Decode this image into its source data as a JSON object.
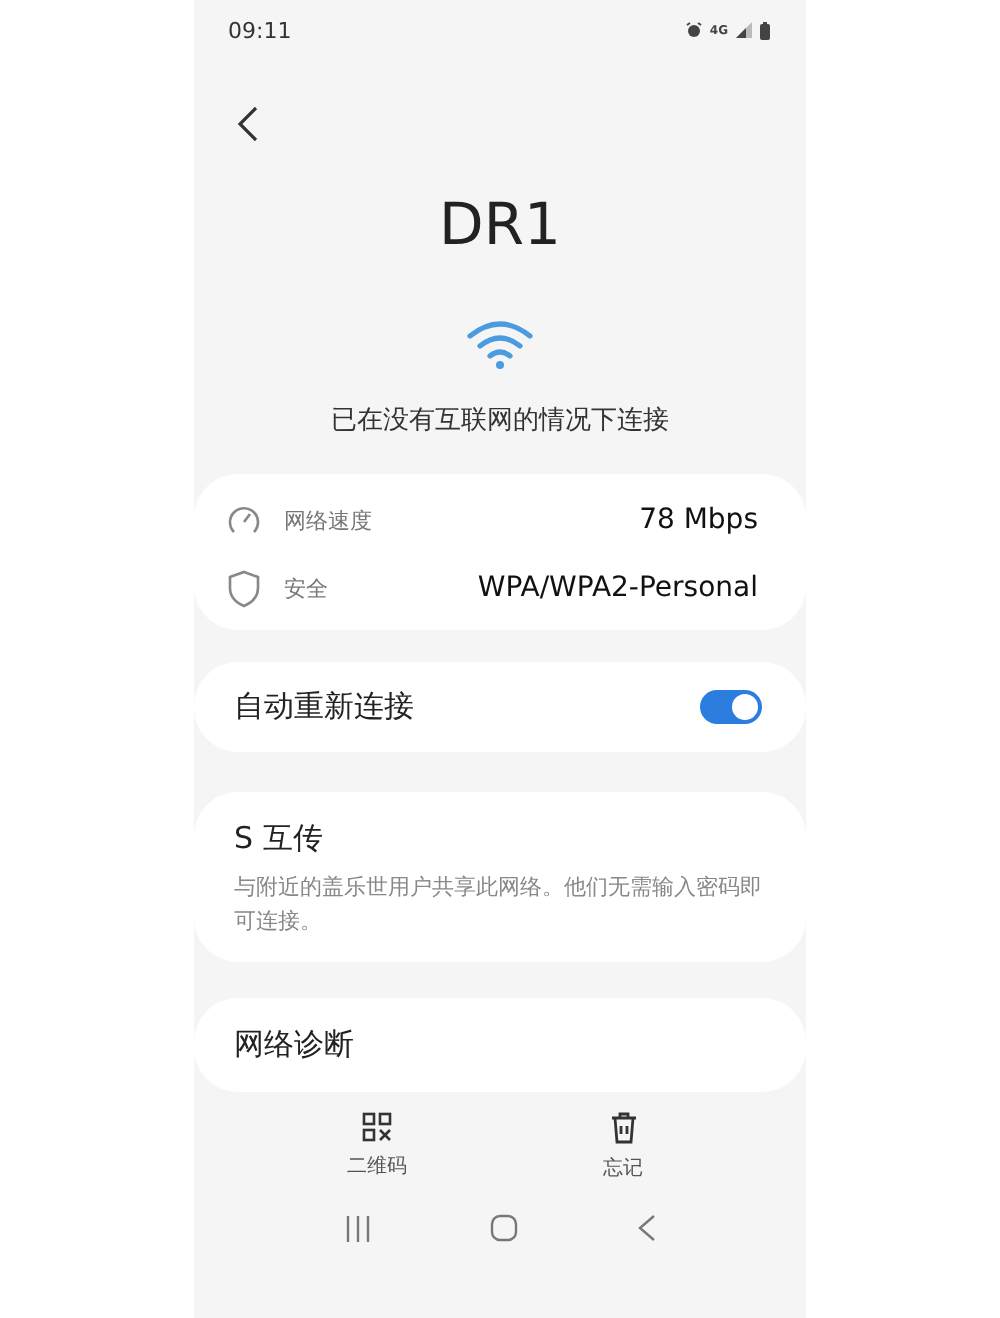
{
  "status_bar": {
    "time": "09:11",
    "network": "4G"
  },
  "network": {
    "name": "DR1",
    "status": "已在没有互联网的情况下连接"
  },
  "details": [
    {
      "kind": "speed",
      "label": "网络速度",
      "value": "78 Mbps"
    },
    {
      "kind": "security",
      "label": "安全",
      "value": "WPA/WPA2-Personal"
    }
  ],
  "auto_reconnect": {
    "label": "自动重新连接",
    "on": true
  },
  "share": {
    "title": "S 互传",
    "description": "与附近的盖乐世用户共享此网络。他们无需输入密码即可连接。"
  },
  "diagnostics": {
    "label": "网络诊断"
  },
  "actions": [
    {
      "kind": "qr",
      "label": "二维码"
    },
    {
      "kind": "forget",
      "label": "忘记"
    }
  ]
}
